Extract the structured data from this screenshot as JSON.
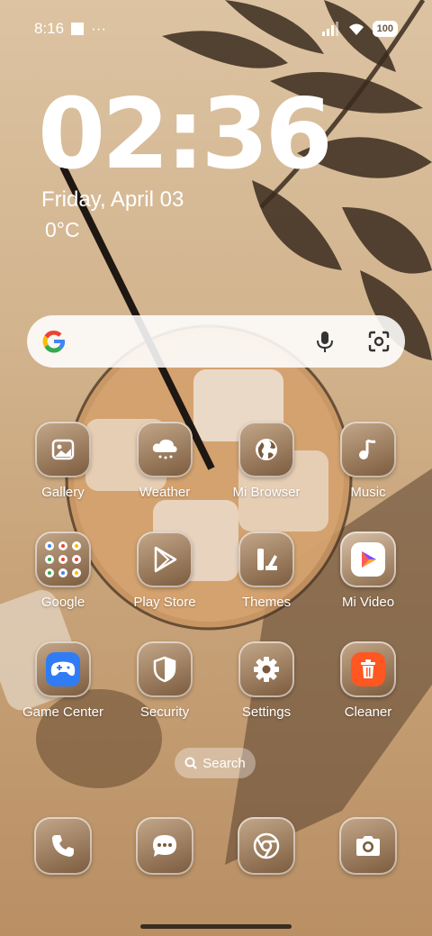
{
  "status_bar": {
    "time": "8:16",
    "more": "···",
    "battery": "100"
  },
  "clock": {
    "time": "02:36",
    "date": "Friday, April 03",
    "temperature": "0°C"
  },
  "search_widget": {
    "icons": [
      "google-icon",
      "mic-icon",
      "lens-icon"
    ]
  },
  "apps": [
    {
      "label": "Gallery",
      "icon": "gallery-icon"
    },
    {
      "label": "Weather",
      "icon": "weather-icon"
    },
    {
      "label": "Mi Browser",
      "icon": "browser-icon"
    },
    {
      "label": "Music",
      "icon": "music-icon"
    },
    {
      "label": "Google",
      "icon": "google-folder-icon"
    },
    {
      "label": "Play Store",
      "icon": "play-store-icon"
    },
    {
      "label": "Themes",
      "icon": "themes-icon"
    },
    {
      "label": "Mi Video",
      "icon": "mi-video-icon"
    },
    {
      "label": "Game Center",
      "icon": "game-center-icon"
    },
    {
      "label": "Security",
      "icon": "security-icon"
    },
    {
      "label": "Settings",
      "icon": "settings-icon"
    },
    {
      "label": "Cleaner",
      "icon": "cleaner-icon"
    }
  ],
  "app_search": {
    "label": "Search"
  },
  "dock": [
    {
      "icon": "phone-icon"
    },
    {
      "icon": "messages-icon"
    },
    {
      "icon": "chrome-icon"
    },
    {
      "icon": "camera-icon"
    }
  ]
}
